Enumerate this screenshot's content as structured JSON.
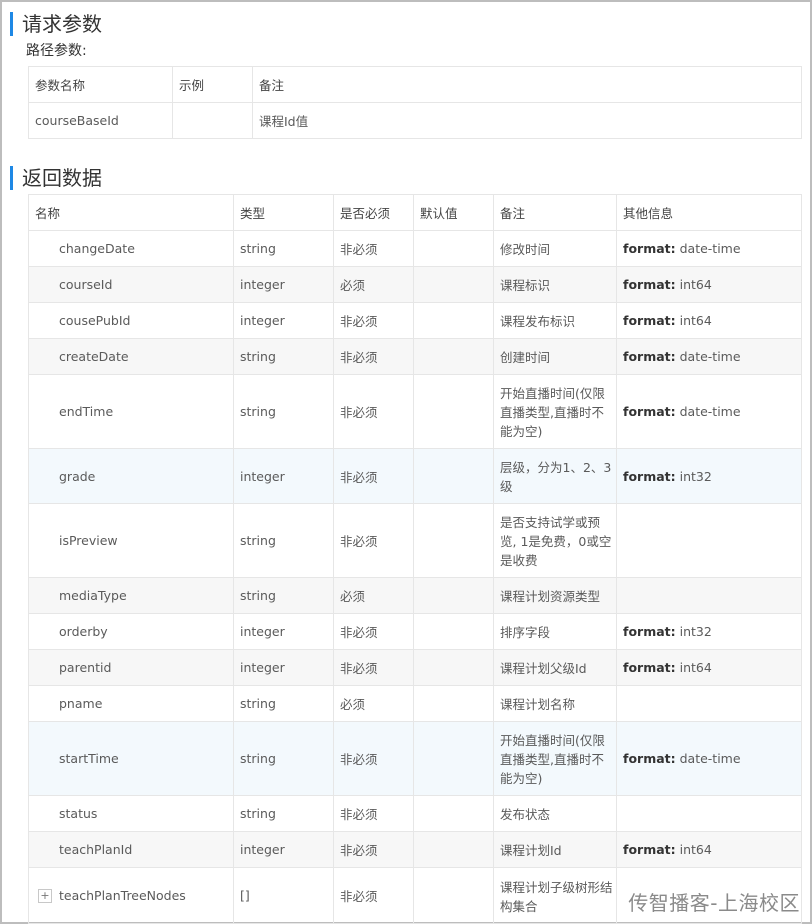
{
  "request_section": {
    "title": "请求参数",
    "path_params_label": "路径参数:",
    "headers": [
      "参数名称",
      "示例",
      "备注"
    ],
    "rows": [
      {
        "name": "courseBaseId",
        "example": "",
        "note": "课程Id值"
      }
    ]
  },
  "response_section": {
    "title": "返回数据",
    "headers": [
      "名称",
      "类型",
      "是否必须",
      "默认值",
      "备注",
      "其他信息"
    ],
    "rows": [
      {
        "name": "changeDate",
        "type": "string",
        "required": "非必须",
        "default": "",
        "note": "修改时间",
        "fmt_key": "format:",
        "fmt_val": "date-time"
      },
      {
        "name": "courseId",
        "type": "integer",
        "required": "必须",
        "default": "",
        "note": "课程标识",
        "fmt_key": "format:",
        "fmt_val": "int64"
      },
      {
        "name": "cousePubId",
        "type": "integer",
        "required": "非必须",
        "default": "",
        "note": "课程发布标识",
        "fmt_key": "format:",
        "fmt_val": "int64"
      },
      {
        "name": "createDate",
        "type": "string",
        "required": "非必须",
        "default": "",
        "note": "创建时间",
        "fmt_key": "format:",
        "fmt_val": "date-time"
      },
      {
        "name": "endTime",
        "type": "string",
        "required": "非必须",
        "default": "",
        "note": "开始直播时间(仅限直播类型,直播时不能为空)",
        "fmt_key": "format:",
        "fmt_val": "date-time"
      },
      {
        "name": "grade",
        "type": "integer",
        "required": "非必须",
        "default": "",
        "note": "层级，分为1、2、3级",
        "fmt_key": "format:",
        "fmt_val": "int32"
      },
      {
        "name": "isPreview",
        "type": "string",
        "required": "非必须",
        "default": "",
        "note": "是否支持试学或预览, 1是免费，0或空是收费",
        "fmt_key": "",
        "fmt_val": ""
      },
      {
        "name": "mediaType",
        "type": "string",
        "required": "必须",
        "default": "",
        "note": "课程计划资源类型",
        "fmt_key": "",
        "fmt_val": ""
      },
      {
        "name": "orderby",
        "type": "integer",
        "required": "非必须",
        "default": "",
        "note": "排序字段",
        "fmt_key": "format:",
        "fmt_val": "int32"
      },
      {
        "name": "parentid",
        "type": "integer",
        "required": "非必须",
        "default": "",
        "note": "课程计划父级Id",
        "fmt_key": "format:",
        "fmt_val": "int64"
      },
      {
        "name": "pname",
        "type": "string",
        "required": "必须",
        "default": "",
        "note": "课程计划名称",
        "fmt_key": "",
        "fmt_val": ""
      },
      {
        "name": "startTime",
        "type": "string",
        "required": "非必须",
        "default": "",
        "note": "开始直播时间(仅限直播类型,直播时不能为空)",
        "fmt_key": "format:",
        "fmt_val": "date-time"
      },
      {
        "name": "status",
        "type": "string",
        "required": "非必须",
        "default": "",
        "note": "发布状态",
        "fmt_key": "",
        "fmt_val": ""
      },
      {
        "name": "teachPlanId",
        "type": "integer",
        "required": "非必须",
        "default": "",
        "note": "课程计划Id",
        "fmt_key": "format:",
        "fmt_val": "int64"
      },
      {
        "name": "teachPlanTreeNodes",
        "type": "[]",
        "required": "非必须",
        "default": "",
        "note": "课程计划子级树形结构集合",
        "fmt_key": "",
        "fmt_val": ""
      }
    ],
    "expander_symbol": "+"
  },
  "watermark": "传智播客-上海校区"
}
